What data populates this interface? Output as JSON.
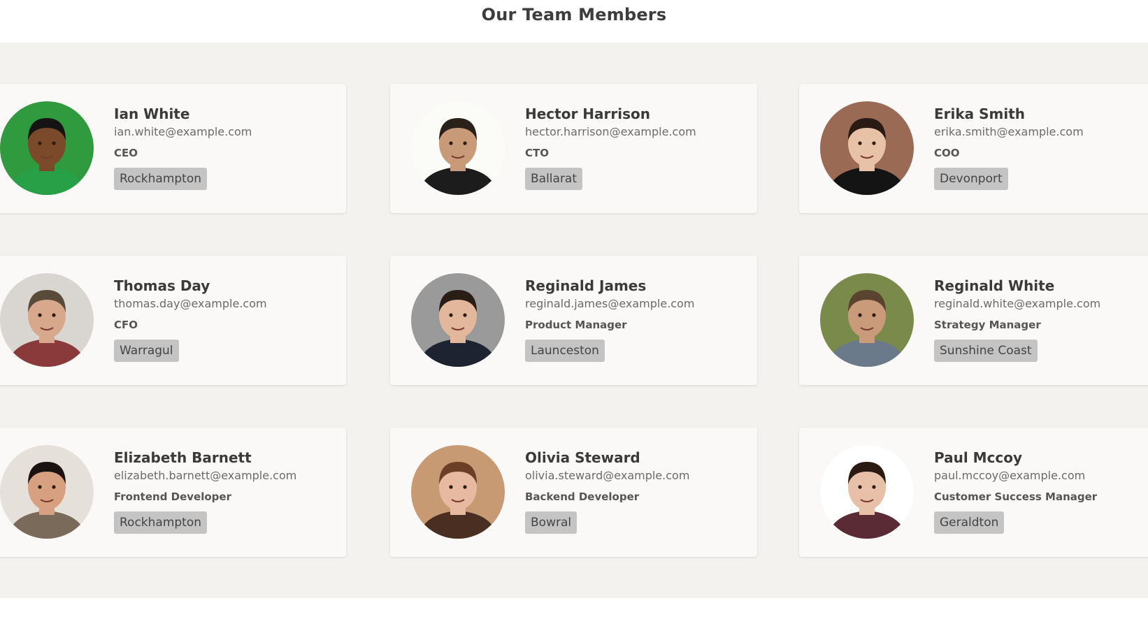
{
  "page": {
    "title": "Our Team Members"
  },
  "colors": {
    "section_background": "#f3f2ef",
    "card_background": "#faf9f7",
    "badge_background": "#c4c4c4"
  },
  "members": [
    {
      "name": "Ian White",
      "email": "ian.white@example.com",
      "role": "CEO",
      "location": "Rockhampton",
      "avatar_bg": "#2f9a3e",
      "skin": "#7a4a2a",
      "hair": "#141414",
      "shirt": "#27a047"
    },
    {
      "name": "Hector Harrison",
      "email": "hector.harrison@example.com",
      "role": "CTO",
      "location": "Ballarat",
      "avatar_bg": "#fbfbf7",
      "skin": "#c89a78",
      "hair": "#2a211b",
      "shirt": "#1c1c1c"
    },
    {
      "name": "Erika Smith",
      "email": "erika.smith@example.com",
      "role": "COO",
      "location": "Devonport",
      "avatar_bg": "#9a6a55",
      "skin": "#e8c2a6",
      "hair": "#2a1a14",
      "shirt": "#141414"
    },
    {
      "name": "Thomas Day",
      "email": "thomas.day@example.com",
      "role": "CFO",
      "location": "Warragul",
      "avatar_bg": "#d9d6d2",
      "skin": "#d7a88b",
      "hair": "#5a4a3a",
      "shirt": "#8a3a3a"
    },
    {
      "name": "Reginald James",
      "email": "reginald.james@example.com",
      "role": "Product Manager",
      "location": "Launceston",
      "avatar_bg": "#9a9a9a",
      "skin": "#e3b79c",
      "hair": "#2a1d16",
      "shirt": "#1d2330"
    },
    {
      "name": "Reginald White",
      "email": "reginald.white@example.com",
      "role": "Strategy Manager",
      "location": "Sunshine Coast",
      "avatar_bg": "#7a8a4a",
      "skin": "#c99b7a",
      "hair": "#5a4430",
      "shirt": "#6a7a8a"
    },
    {
      "name": "Elizabeth Barnett",
      "email": "elizabeth.barnett@example.com",
      "role": "Frontend Developer",
      "location": "Rockhampton",
      "avatar_bg": "#e6e0da",
      "skin": "#d7a080",
      "hair": "#1a1210",
      "shirt": "#7a6a5a"
    },
    {
      "name": "Olivia Steward",
      "email": "olivia.steward@example.com",
      "role": "Backend Developer",
      "location": "Bowral",
      "avatar_bg": "#c79a74",
      "skin": "#e7b9a0",
      "hair": "#6b3f26",
      "shirt": "#4a2e22"
    },
    {
      "name": "Paul Mccoy",
      "email": "paul.mccoy@example.com",
      "role": "Customer Success Manager",
      "location": "Geraldton",
      "avatar_bg": "#ffffff",
      "skin": "#e8c0a8",
      "hair": "#2a1a12",
      "shirt": "#5a2a35"
    }
  ]
}
